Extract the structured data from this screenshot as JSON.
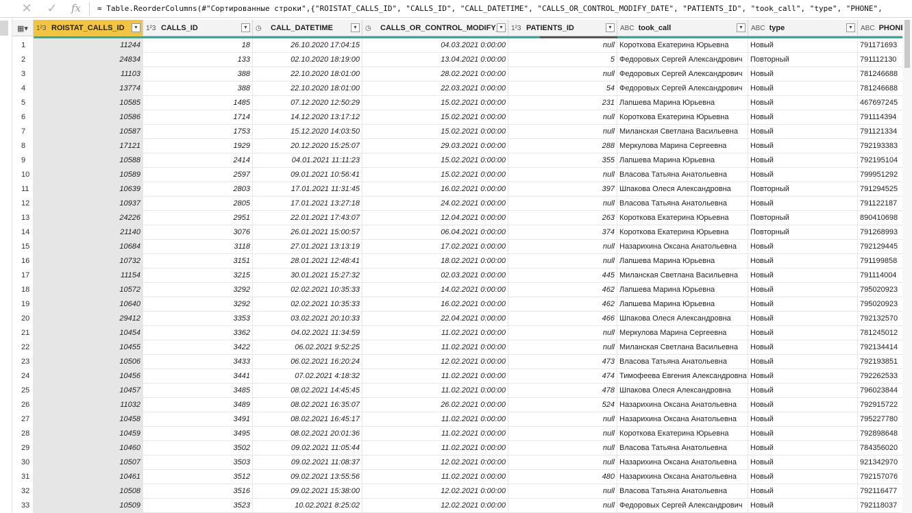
{
  "formula": "= Table.ReorderColumns(#\"Сортированные строки\",{\"ROISTAT_CALLS_ID\", \"CALLS_ID\", \"CALL_DATETIME\", \"CALLS_OR_CONTROL_MODIFY_DATE\", \"PATIENTS_ID\", \"took_call\", \"type\", \"PHONE\",",
  "formula_bar": {
    "cancel_icon": "✕",
    "confirm_icon": "✓",
    "fx_label": "fx"
  },
  "corner_icon": "▦▾",
  "columns": [
    {
      "key": "roistat",
      "type": "1²3",
      "label": "ROISTAT_CALLS_ID",
      "selected": true
    },
    {
      "key": "calls",
      "type": "1²3",
      "label": "CALLS_ID"
    },
    {
      "key": "dt",
      "type": "◷",
      "label": "CALL_DATETIME"
    },
    {
      "key": "mod",
      "type": "◷",
      "label": "CALLS_OR_CONTROL_MODIFY_..."
    },
    {
      "key": "pid",
      "type": "1²3",
      "label": "PATIENTS_ID"
    },
    {
      "key": "took",
      "type": "ABC",
      "label": "took_call"
    },
    {
      "key": "type",
      "type": "ABC",
      "label": "type"
    },
    {
      "key": "phone",
      "type": "ABC",
      "label": "PHONE"
    }
  ],
  "rows": [
    [
      "1",
      "11244",
      "18",
      "26.10.2020 17:04:15",
      "04.03.2021 0:00:00",
      "null",
      "Короткова Екатерина Юрьевна",
      "Новый",
      "791171693"
    ],
    [
      "2",
      "24834",
      "133",
      "02.10.2020 18:19:00",
      "13.04.2021 0:00:00",
      "5",
      "Федоровых Сергей Александрович",
      "Повторный",
      "791112130"
    ],
    [
      "3",
      "11103",
      "388",
      "22.10.2020 18:01:00",
      "28.02.2021 0:00:00",
      "null",
      "Федоровых Сергей Александрович",
      "Новый",
      "781246688"
    ],
    [
      "4",
      "13774",
      "388",
      "22.10.2020 18:01:00",
      "22.03.2021 0:00:00",
      "54",
      "Федоровых Сергей Александрович",
      "Новый",
      "781246688"
    ],
    [
      "5",
      "10585",
      "1485",
      "07.12.2020 12:50:29",
      "15.02.2021 0:00:00",
      "231",
      "Лапшева Марина Юрьевна",
      "Новый",
      "467697245"
    ],
    [
      "6",
      "10586",
      "1714",
      "14.12.2020 13:17:12",
      "15.02.2021 0:00:00",
      "null",
      "Короткова Екатерина Юрьевна",
      "Новый",
      "791114394"
    ],
    [
      "7",
      "10587",
      "1753",
      "15.12.2020 14:03:50",
      "15.02.2021 0:00:00",
      "null",
      "Миланская Светлана Васильевна",
      "Новый",
      "791121334"
    ],
    [
      "8",
      "17121",
      "1929",
      "20.12.2020 15:25:07",
      "29.03.2021 0:00:00",
      "288",
      "Меркулова Марина Сергеевна",
      "Новый",
      "792193383"
    ],
    [
      "9",
      "10588",
      "2414",
      "04.01.2021 11:11:23",
      "15.02.2021 0:00:00",
      "355",
      "Лапшева Марина Юрьевна",
      "Новый",
      "792195104"
    ],
    [
      "10",
      "10589",
      "2597",
      "09.01.2021 10:56:41",
      "15.02.2021 0:00:00",
      "null",
      "Власова Татьяна Анатольевна",
      "Новый",
      "799951292"
    ],
    [
      "11",
      "10639",
      "2803",
      "17.01.2021 11:31:45",
      "16.02.2021 0:00:00",
      "397",
      "Шпакова Олеся Александровна",
      "Повторный",
      "791294525"
    ],
    [
      "12",
      "10937",
      "2805",
      "17.01.2021 13:27:18",
      "24.02.2021 0:00:00",
      "null",
      "Власова Татьяна Анатольевна",
      "Новый",
      "791122187"
    ],
    [
      "13",
      "24226",
      "2951",
      "22.01.2021 17:43:07",
      "12.04.2021 0:00:00",
      "263",
      "Короткова Екатерина Юрьевна",
      "Повторный",
      "890410698"
    ],
    [
      "14",
      "21140",
      "3076",
      "26.01.2021 15:00:57",
      "06.04.2021 0:00:00",
      "374",
      "Короткова Екатерина Юрьевна",
      "Повторный",
      "791268993"
    ],
    [
      "15",
      "10684",
      "3118",
      "27.01.2021 13:13:19",
      "17.02.2021 0:00:00",
      "null",
      "Назарихина Оксана Анатольевна",
      "Новый",
      "792129445"
    ],
    [
      "16",
      "10732",
      "3151",
      "28.01.2021 12:48:41",
      "18.02.2021 0:00:00",
      "null",
      "Лапшева Марина Юрьевна",
      "Новый",
      "791199858"
    ],
    [
      "17",
      "11154",
      "3215",
      "30.01.2021 15:27:32",
      "02.03.2021 0:00:00",
      "445",
      "Миланская Светлана Васильевна",
      "Новый",
      "791114004"
    ],
    [
      "18",
      "10572",
      "3292",
      "02.02.2021 10:35:33",
      "14.02.2021 0:00:00",
      "462",
      "Лапшева Марина Юрьевна",
      "Новый",
      "795020923"
    ],
    [
      "19",
      "10640",
      "3292",
      "02.02.2021 10:35:33",
      "16.02.2021 0:00:00",
      "462",
      "Лапшева Марина Юрьевна",
      "Новый",
      "795020923"
    ],
    [
      "20",
      "29412",
      "3353",
      "03.02.2021 20:10:33",
      "22.04.2021 0:00:00",
      "466",
      "Шпакова Олеся Александровна",
      "Новый",
      "792132570"
    ],
    [
      "21",
      "10454",
      "3362",
      "04.02.2021 11:34:59",
      "11.02.2021 0:00:00",
      "null",
      "Меркулова Марина Сергеевна",
      "Новый",
      "781245012"
    ],
    [
      "22",
      "10455",
      "3422",
      "06.02.2021 9:52:25",
      "11.02.2021 0:00:00",
      "null",
      "Миланская Светлана Васильевна",
      "Новый",
      "792134414"
    ],
    [
      "23",
      "10506",
      "3433",
      "06.02.2021 16:20:24",
      "12.02.2021 0:00:00",
      "473",
      "Власова Татьяна Анатольевна",
      "Новый",
      "792193851"
    ],
    [
      "24",
      "10456",
      "3441",
      "07.02.2021 4:18:32",
      "11.02.2021 0:00:00",
      "474",
      "Тимофеева Евгения Александровна",
      "Новый",
      "792262533"
    ],
    [
      "25",
      "10457",
      "3485",
      "08.02.2021 14:45:45",
      "11.02.2021 0:00:00",
      "478",
      "Шпакова Олеся Александровна",
      "Новый",
      "796023844"
    ],
    [
      "26",
      "11032",
      "3489",
      "08.02.2021 16:35:07",
      "26.02.2021 0:00:00",
      "524",
      "Назарихина Оксана Анатольевна",
      "Новый",
      "792915722"
    ],
    [
      "27",
      "10458",
      "3491",
      "08.02.2021 16:45:17",
      "11.02.2021 0:00:00",
      "null",
      "Назарихина Оксана Анатольевна",
      "Новый",
      "795227780"
    ],
    [
      "28",
      "10459",
      "3495",
      "08.02.2021 20:01:36",
      "11.02.2021 0:00:00",
      "null",
      "Короткова Екатерина Юрьевна",
      "Новый",
      "792898648"
    ],
    [
      "29",
      "10460",
      "3502",
      "09.02.2021 11:05:44",
      "11.02.2021 0:00:00",
      "null",
      "Власова Татьяна Анатольевна",
      "Новый",
      "784356020"
    ],
    [
      "30",
      "10507",
      "3503",
      "09.02.2021 11:08:37",
      "12.02.2021 0:00:00",
      "null",
      "Назарихина Оксана Анатольевна",
      "Новый",
      "921342970"
    ],
    [
      "31",
      "10461",
      "3512",
      "09.02.2021 13:55:56",
      "11.02.2021 0:00:00",
      "480",
      "Назарихина Оксана Анатольевна",
      "Новый",
      "792157076"
    ],
    [
      "32",
      "10508",
      "3516",
      "09.02.2021 15:38:00",
      "12.02.2021 0:00:00",
      "null",
      "Власова Татьяна Анатольевна",
      "Новый",
      "792116477"
    ],
    [
      "33",
      "10509",
      "3523",
      "10.02.2021 8:25:02",
      "12.02.2021 0:00:00",
      "null",
      "Федоровых Сергей Александрович",
      "Новый",
      "792118037"
    ]
  ],
  "colors": {
    "selected_header": "#f3c440",
    "quality_ok": "#1db3a0",
    "quality_dark": "#555555"
  }
}
